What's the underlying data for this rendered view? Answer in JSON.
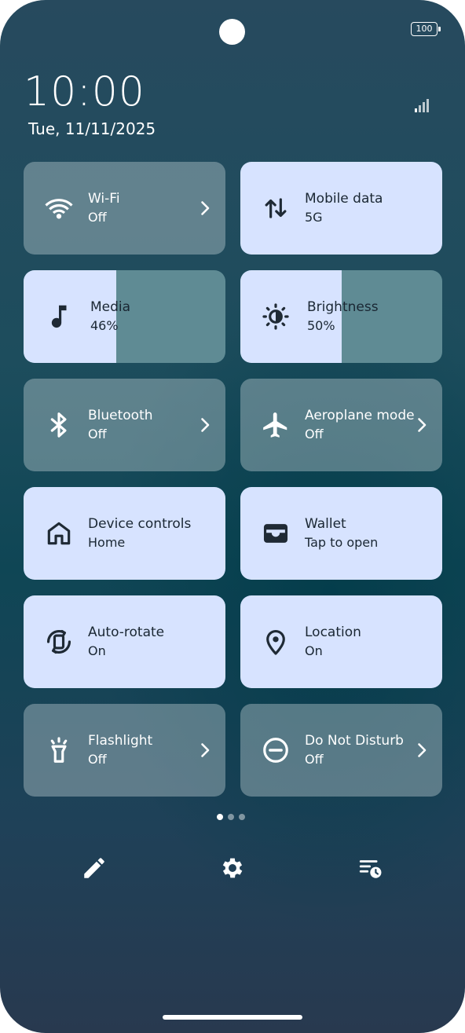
{
  "status": {
    "battery": "100",
    "signal_icon": "cell-signal-icon"
  },
  "header": {
    "time": "10:00",
    "date": "Tue, 11/11/2025"
  },
  "colors": {
    "tile_on": "#d7e3ff",
    "tile_off": "rgba(188,205,210,0.42)",
    "slider_track": "#5f8b94"
  },
  "tiles": [
    {
      "label": "Wi-Fi",
      "sub": "Off",
      "icon": "wifi-icon",
      "state": "off",
      "chevron": true
    },
    {
      "label": "Mobile data",
      "sub": "5G",
      "icon": "mobile-data-icon",
      "state": "on",
      "chevron": false
    },
    {
      "label": "Media",
      "sub": "46%",
      "icon": "music-note-icon",
      "state": "slider",
      "level": 0.46
    },
    {
      "label": "Brightness",
      "sub": "50%",
      "icon": "brightness-icon",
      "state": "slider",
      "level": 0.5
    },
    {
      "label": "Bluetooth",
      "sub": "Off",
      "icon": "bluetooth-icon",
      "state": "off",
      "chevron": true
    },
    {
      "label": "Aeroplane mode",
      "sub": "Off",
      "icon": "airplane-icon",
      "state": "off",
      "chevron": true
    },
    {
      "label": "Device controls",
      "sub": "Home",
      "icon": "home-icon",
      "state": "on",
      "chevron": false
    },
    {
      "label": "Wallet",
      "sub": "Tap to open",
      "icon": "wallet-icon",
      "state": "on",
      "chevron": false
    },
    {
      "label": "Auto-rotate",
      "sub": "On",
      "icon": "auto-rotate-icon",
      "state": "on",
      "chevron": false
    },
    {
      "label": "Location",
      "sub": "On",
      "icon": "location-pin-icon",
      "state": "on",
      "chevron": false
    },
    {
      "label": "Flashlight",
      "sub": "Off",
      "icon": "flashlight-icon",
      "state": "off",
      "chevron": true
    },
    {
      "label": "Do Not Disturb",
      "sub": "Off",
      "icon": "do-not-disturb-icon",
      "state": "off",
      "chevron": true
    }
  ],
  "pager": {
    "pages": 3,
    "active": 0
  },
  "footer": {
    "edit_icon": "edit-pencil-icon",
    "settings_icon": "settings-gear-icon",
    "history_icon": "notification-history-icon"
  }
}
